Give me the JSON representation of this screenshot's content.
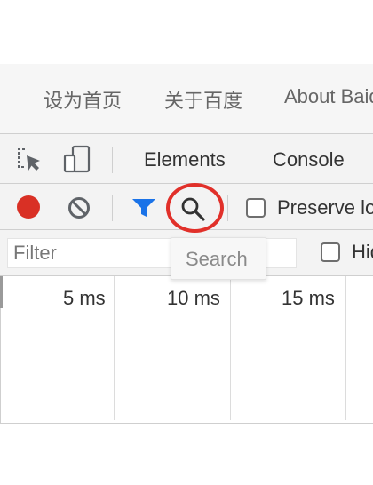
{
  "baidu_nav": {
    "links": [
      "设为首页",
      "关于百度",
      "About Baidu"
    ]
  },
  "devtools": {
    "tabs": [
      "Elements",
      "Console"
    ],
    "toolbar": {
      "preserve_log_label": "Preserve log"
    },
    "filter": {
      "placeholder": "Filter",
      "hide_data_urls_label": "Hide data URLs"
    },
    "tooltip": "Search",
    "timeline": {
      "ticks": [
        "5 ms",
        "10 ms",
        "15 ms"
      ]
    }
  },
  "colors": {
    "record": "#d93025",
    "filter_icon": "#1a73e8",
    "highlight_circle": "#e1302a"
  }
}
